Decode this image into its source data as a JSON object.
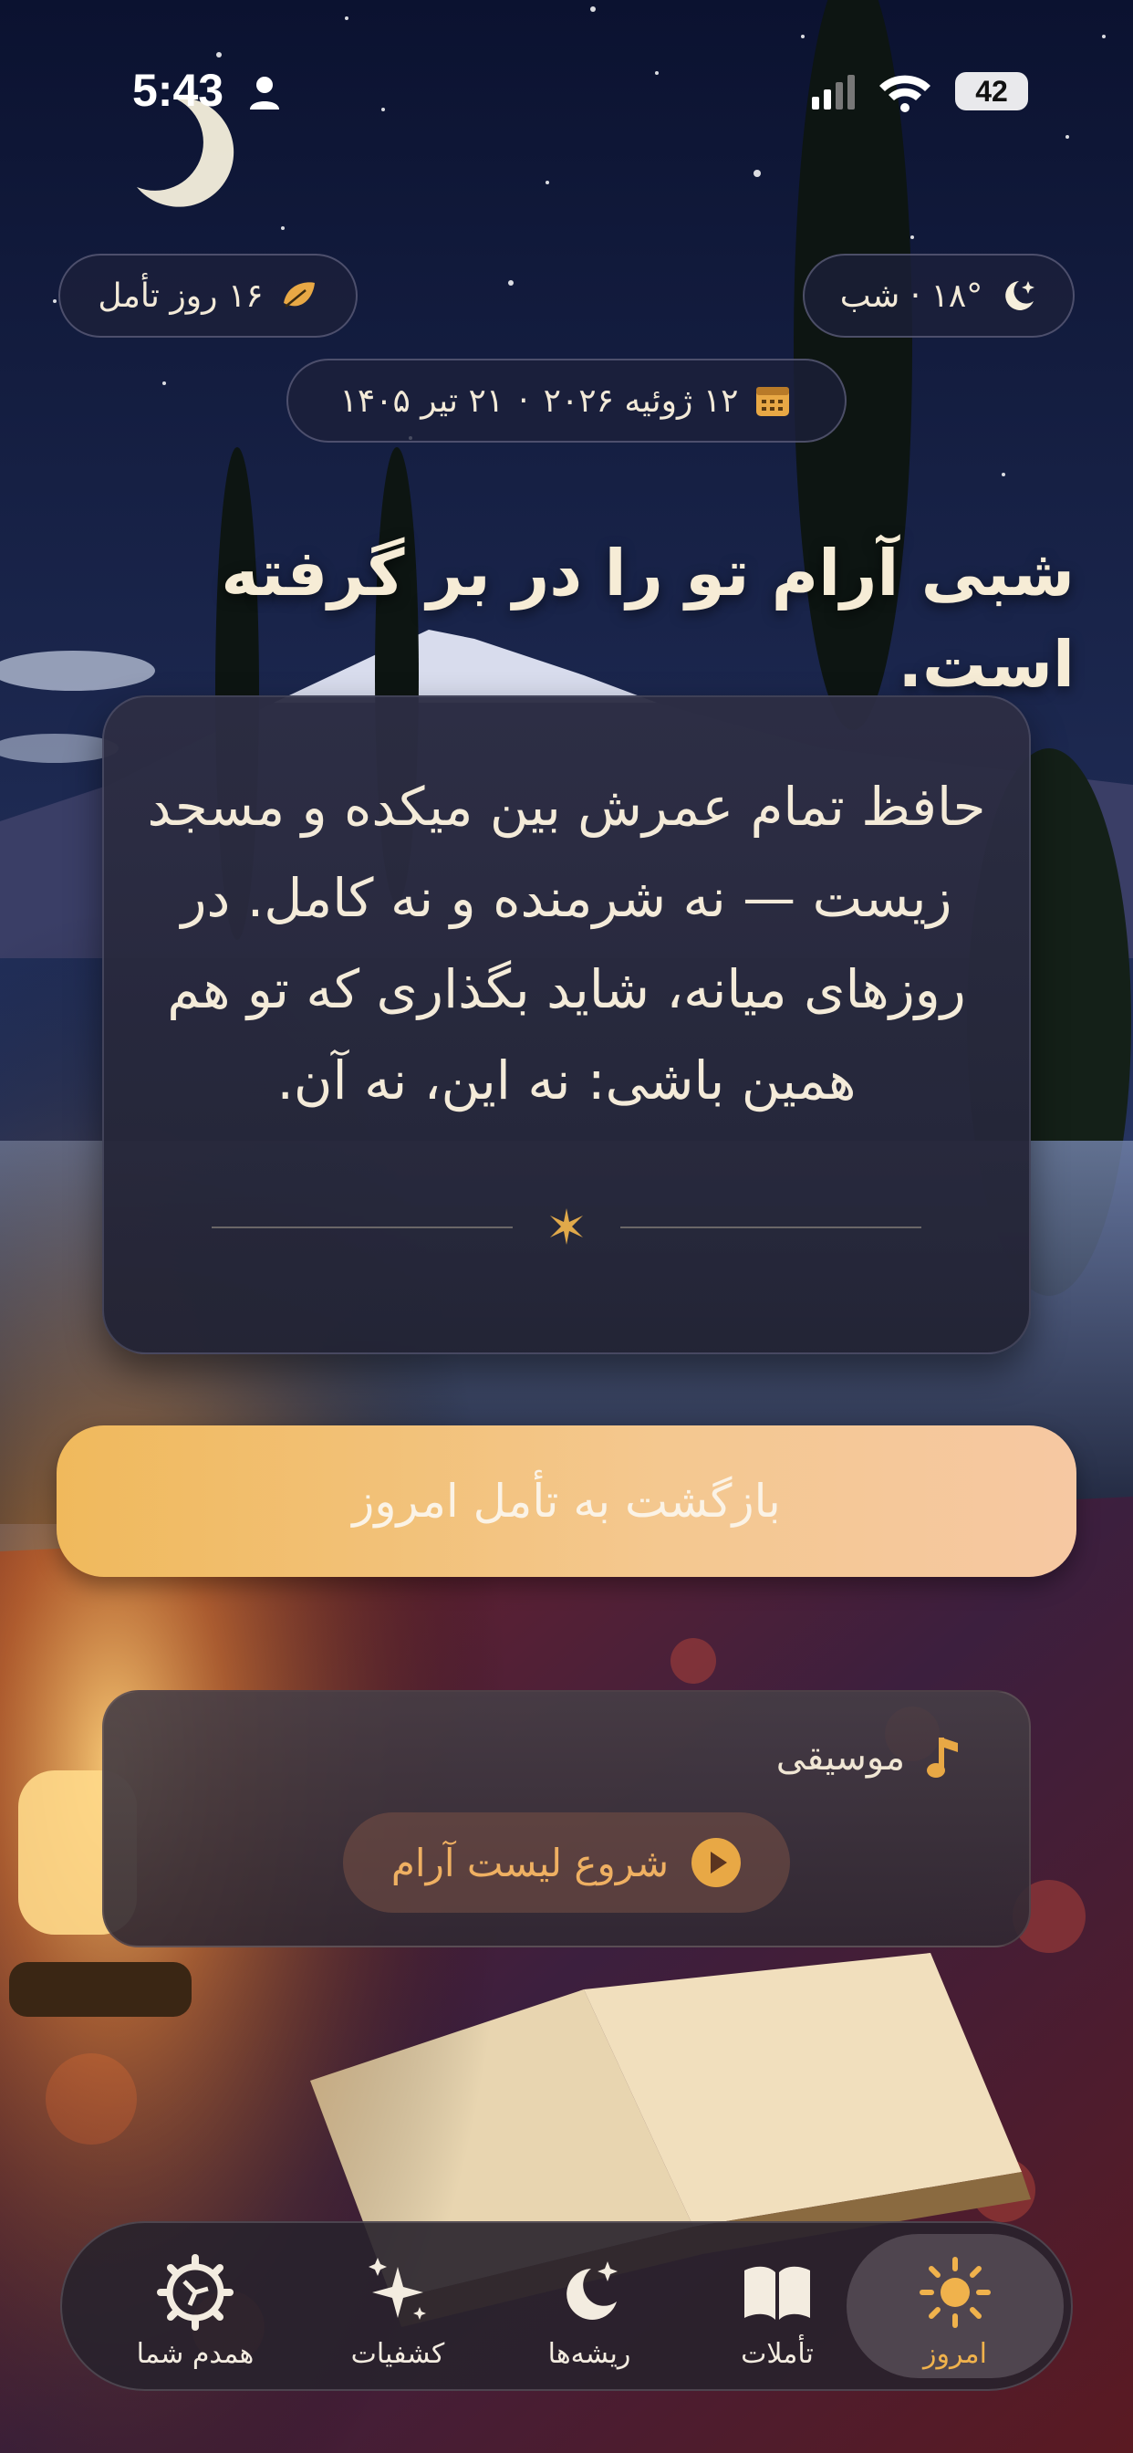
{
  "status_bar": {
    "time": "5:43",
    "battery": "42"
  },
  "header": {
    "weather": "۱۸° · شب",
    "streak": "۱۶ روز تأمل",
    "date_gregorian": "۱۲ ژوئیه ۲۰۲۶",
    "date_separator": "·",
    "date_persian": "۲۱ تیر ۱۴۰۵"
  },
  "headline": "شبی آرام تو را در بر گرفته است.",
  "reflection": {
    "quote": "حافظ تمام عمرش بین میکده و مسجد زیست — نه شرمنده و نه کامل. در روزهای میانه، شاید بگذاری که تو هم همین باشی: نه این، نه آن."
  },
  "back_button_label": "بازگشت به تأمل امروز",
  "music": {
    "title": "موسیقی",
    "play_label": "شروع لیست آرام"
  },
  "tabs": [
    {
      "label": "امروز",
      "icon": "sun-icon",
      "active": true
    },
    {
      "label": "تأملات",
      "icon": "open-book-icon",
      "active": false
    },
    {
      "label": "ریشه‌ها",
      "icon": "moon-stars-icon",
      "active": false
    },
    {
      "label": "کشفیات",
      "icon": "sparkles-icon",
      "active": false
    },
    {
      "label": "همدم شما",
      "icon": "gear-icon",
      "active": false
    }
  ],
  "colors": {
    "accent": "#f0b24c",
    "button_gradient_start": "#f0b95c",
    "button_gradient_end": "#f6c8a2"
  }
}
